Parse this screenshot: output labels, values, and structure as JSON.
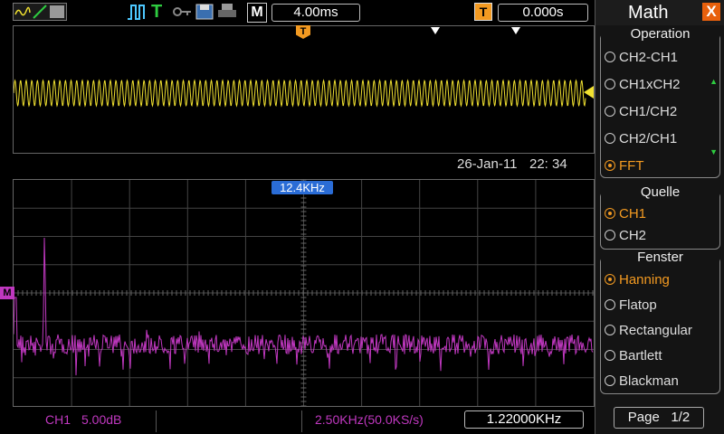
{
  "toolbar": {
    "timebase": "4.00ms",
    "trigger_offset": "0.000s",
    "mode_label": "M",
    "trigger_icon_label": "T",
    "trig_marker": "T"
  },
  "top_screen": {
    "date": "26-Jan-11",
    "time": "22: 34",
    "wave_color": "#f0e030"
  },
  "bottom_screen": {
    "cursor_freq": "12.4KHz",
    "ch_marker": "M",
    "wave_color": "#c038c0"
  },
  "status": {
    "channel": "CH1",
    "scale": "5.00dB",
    "span": "2.50KHz(50.0KS/s)",
    "cursor_readout": "1.22000KHz"
  },
  "menu": {
    "title": "Math",
    "close": "X",
    "operation": {
      "title": "Operation",
      "options": [
        "CH2-CH1",
        "CH1xCH2",
        "CH1/CH2",
        "CH2/CH1",
        "FFT"
      ],
      "selected": "FFT"
    },
    "source": {
      "title": "Quelle",
      "options": [
        "CH1",
        "CH2"
      ],
      "selected": "CH1"
    },
    "window": {
      "title": "Fenster",
      "options": [
        "Hanning",
        "Flatop",
        "Rectangular",
        "Bartlett",
        "Blackman"
      ],
      "selected": "Hanning"
    },
    "page": "Page   1/2"
  },
  "colors": {
    "accent": "#f39a21",
    "trace_yellow": "#f0e030",
    "trace_magenta": "#c038c0",
    "cursor_blue": "#2a6cd6",
    "close_orange": "#e8600c"
  }
}
